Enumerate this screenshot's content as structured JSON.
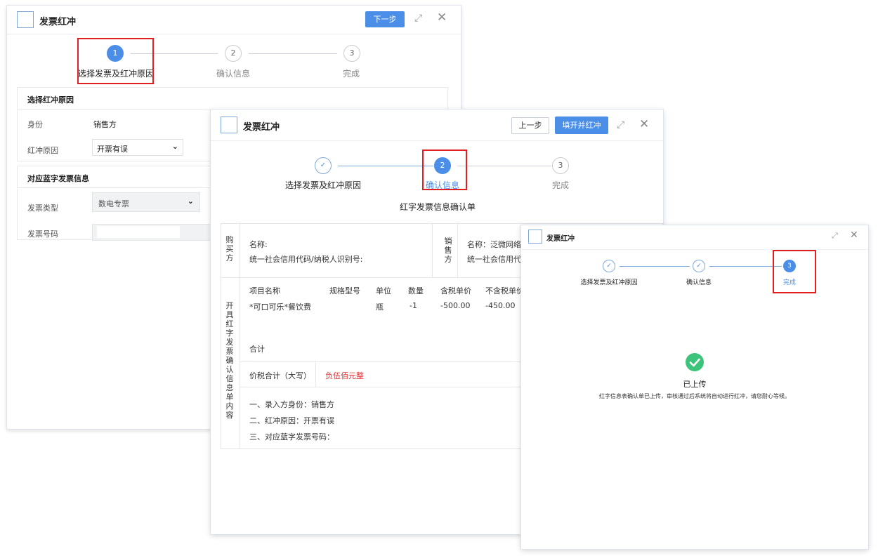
{
  "win1": {
    "title": "发票红冲",
    "next_btn": "下一步",
    "steps": [
      {
        "num": "1",
        "label": "选择发票及红冲原因"
      },
      {
        "num": "2",
        "label": "确认信息"
      },
      {
        "num": "3",
        "label": "完成"
      }
    ],
    "section1_title": "选择红冲原因",
    "identity_label": "身份",
    "identity_value": "销售方",
    "reason_label": "红冲原因",
    "reason_value": "开票有误",
    "section2_title": "对应蓝字发票信息",
    "invoice_type_label": "发票类型",
    "invoice_type_value": "数电专票",
    "invoice_no_label": "发票号码",
    "invoice_no_value": ""
  },
  "win2": {
    "title": "发票红冲",
    "prev_btn": "上一步",
    "submit_btn": "填开并红冲",
    "steps": [
      {
        "num": "",
        "label": "选择发票及红冲原因"
      },
      {
        "num": "2",
        "label": "确认信息"
      },
      {
        "num": "3",
        "label": "完成"
      }
    ],
    "form_title": "红字发票信息确认单",
    "buyer_vlabel": "购买方",
    "buyer_name": "名称:",
    "buyer_credit": "统一社会信用代码/纳税人识别号:",
    "seller_vlabel": "销售方",
    "seller_name": "名称：泛微网络",
    "seller_credit": "统一社会信用代码",
    "content_vlabel": "开具红字发票确认信息单内容",
    "table_headers": [
      "项目名称",
      "规格型号",
      "单位",
      "数量",
      "含税单价",
      "不含税单价"
    ],
    "item": {
      "name": "*可口可乐*餐饮费",
      "spec": "",
      "unit": "瓶",
      "qty": "-1",
      "price_tax": "-500.00",
      "price": "-450.00"
    },
    "total_label": "合计",
    "tax_total_label": "价税合计（大写）",
    "tax_total_value": "负伍佰元整",
    "notes": [
      "一、录入方身份：销售方",
      "二、红冲原因：开票有误",
      "三、对应蓝字发票号码："
    ]
  },
  "win3": {
    "title": "发票红冲",
    "steps": [
      {
        "num": "",
        "label": "选择发票及红冲原因"
      },
      {
        "num": "",
        "label": "确认信息"
      },
      {
        "num": "3",
        "label": "完成"
      }
    ],
    "status": "已上传",
    "message": "红字信息表确认单已上传，审核通过后系统将自动进行红冲，请您耐心等候。"
  },
  "colors": {
    "primary": "#4a8ee8",
    "highlight_box": "#e02020",
    "negative_text": "#e03030",
    "success": "#3bc47a"
  }
}
